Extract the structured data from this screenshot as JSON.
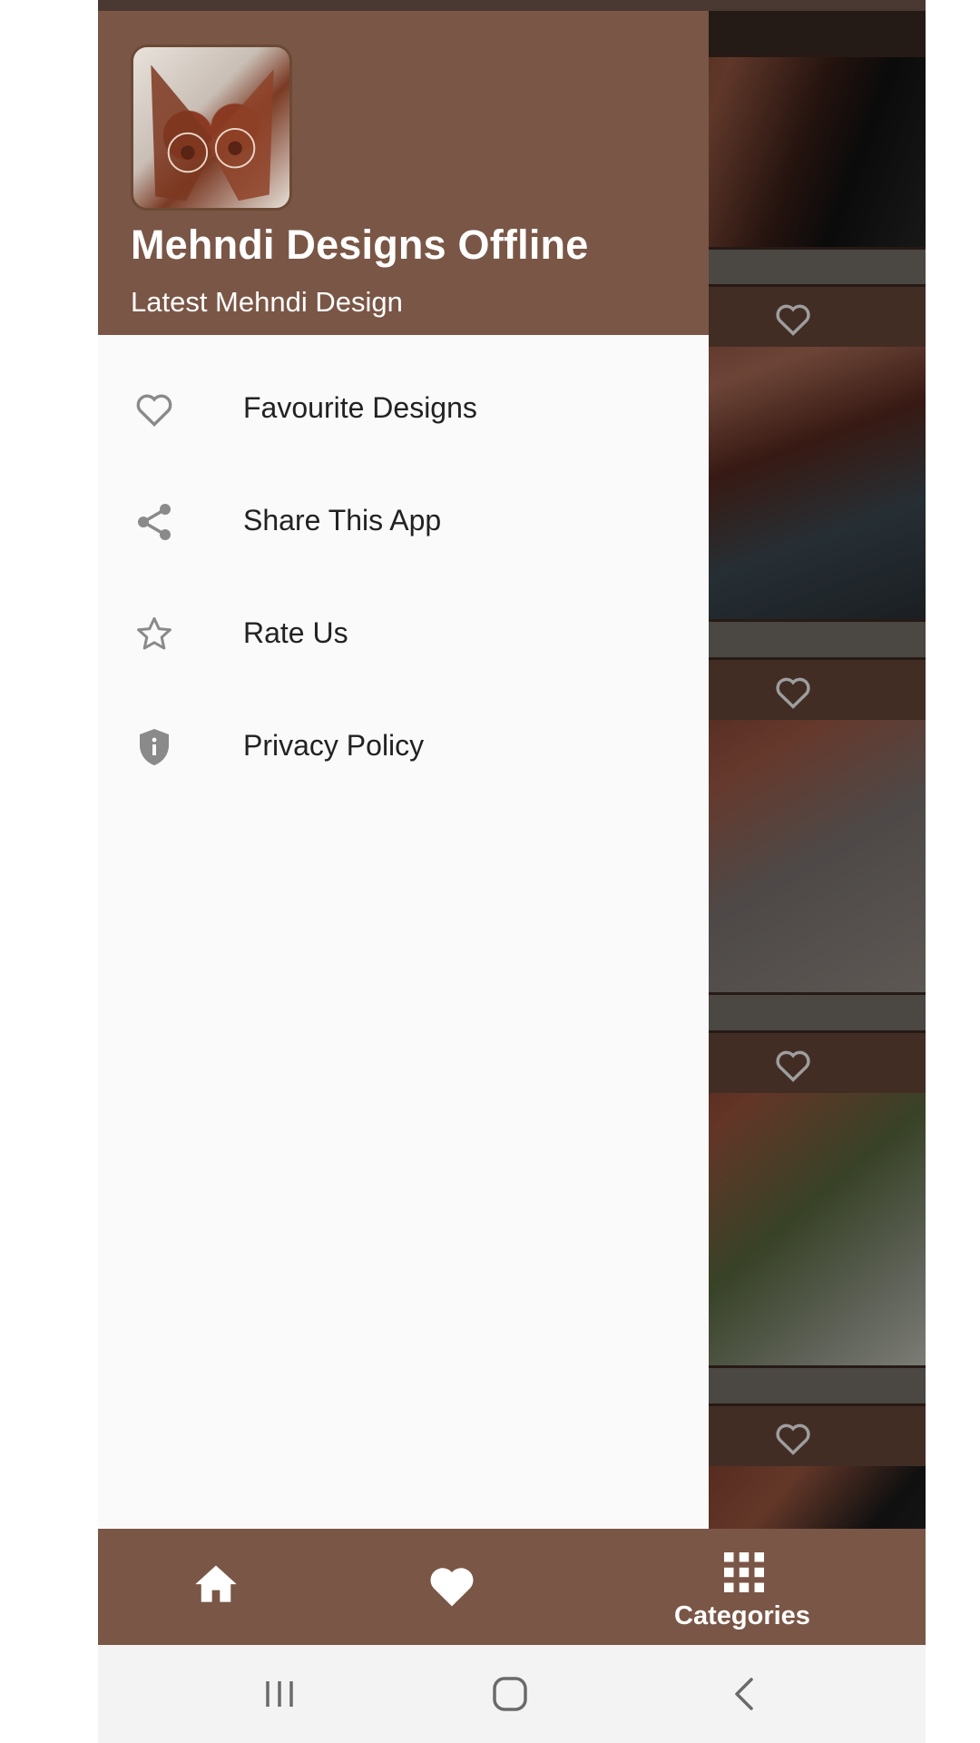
{
  "drawer": {
    "app_title": "Mehndi Designs Offline",
    "app_subtitle": "Latest Mehndi Design",
    "logo_icon": "mehndi-hands-logo",
    "menu": [
      {
        "label": "Favourite Designs",
        "icon": "heart-outline-icon"
      },
      {
        "label": "Share This App",
        "icon": "share-icon"
      },
      {
        "label": "Rate Us",
        "icon": "star-outline-icon"
      },
      {
        "label": "Privacy Policy",
        "icon": "shield-info-icon"
      }
    ]
  },
  "bottom_nav": {
    "items": [
      {
        "icon": "home-icon",
        "label": ""
      },
      {
        "icon": "heart-filled-icon",
        "label": ""
      },
      {
        "icon": "grid-icon",
        "label": "Categories"
      }
    ]
  },
  "system_nav": [
    "recent-apps-icon",
    "home-circle-icon",
    "back-chevron-icon"
  ],
  "colors": {
    "brand_brown": "#7a5646",
    "dark_topbar": "#3a2a24",
    "drawer_bg": "#fafafa",
    "menu_text": "#222222",
    "icon_grey": "#8a8a8a"
  }
}
